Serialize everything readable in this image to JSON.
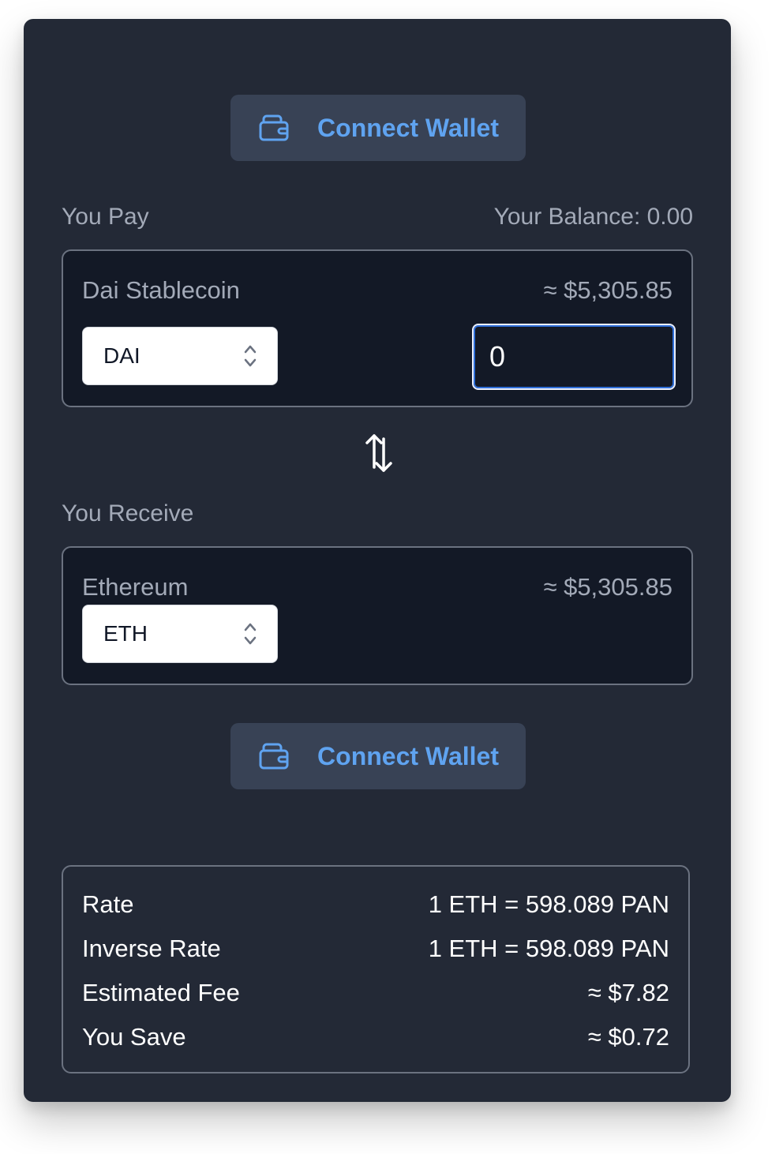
{
  "wallet": {
    "connect_label": "Connect Wallet",
    "icon": "wallet-icon"
  },
  "pay": {
    "label": "You Pay",
    "balance_text": "Your Balance: 0.00",
    "token_name": "Dai Stablecoin",
    "usd_value": "≈ $5,305.85",
    "token_symbol": "DAI",
    "amount": "0"
  },
  "swap_icon": "swap-arrows-icon",
  "receive": {
    "label": "You Receive",
    "token_name": "Ethereum",
    "usd_value": "≈ $5,305.85",
    "token_symbol": "ETH"
  },
  "info": {
    "rows": [
      {
        "label": "Rate",
        "value": "1 ETH = 598.089 PAN"
      },
      {
        "label": "Inverse Rate",
        "value": "1 ETH = 598.089 PAN"
      },
      {
        "label": "Estimated Fee",
        "value": "≈ $7.82"
      },
      {
        "label": "You Save",
        "value": "≈ $0.72"
      }
    ]
  },
  "colors": {
    "card_bg": "#232936",
    "panel_bg": "#131926",
    "button_bg": "#384255",
    "accent_blue": "#5fa3f0",
    "muted_text": "#a3aab8",
    "focus_blue": "#2f6ed8"
  }
}
